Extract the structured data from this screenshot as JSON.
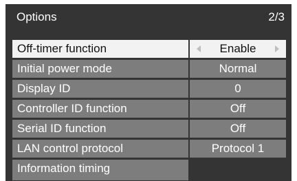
{
  "header": {
    "title": "Options",
    "page_indicator": "2/3"
  },
  "rows": [
    {
      "label": "Off-timer function",
      "value": "Enable"
    },
    {
      "label": "Initial power mode",
      "value": "Normal"
    },
    {
      "label": "Display ID",
      "value": "0"
    },
    {
      "label": "Controller ID function",
      "value": "Off"
    },
    {
      "label": "Serial ID function",
      "value": "Off"
    },
    {
      "label": "LAN control protocol",
      "value": "Protocol 1"
    },
    {
      "label": "Information timing",
      "value": ""
    }
  ],
  "icons": {
    "left": "left-arrow-icon",
    "right": "right-arrow-icon"
  },
  "colors": {
    "background": "#343434",
    "row": "#7d7d7d",
    "selected_row": "#f2f2f2",
    "text": "#ffffff",
    "selected_text": "#111111"
  }
}
